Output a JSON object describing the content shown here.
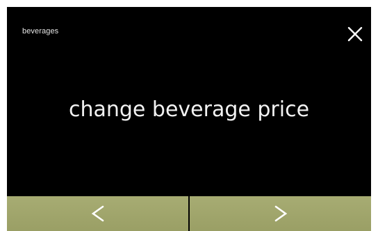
{
  "header": {
    "title": "beverages",
    "close_icon": "close-icon"
  },
  "main": {
    "text": "change beverage price"
  },
  "nav": {
    "prev_icon": "chevron-left-icon",
    "next_icon": "chevron-right-icon"
  },
  "colors": {
    "background": "#000000",
    "text": "#f2f2f2",
    "nav_button": "#a2a76d",
    "nav_icon": "#ffffff"
  }
}
